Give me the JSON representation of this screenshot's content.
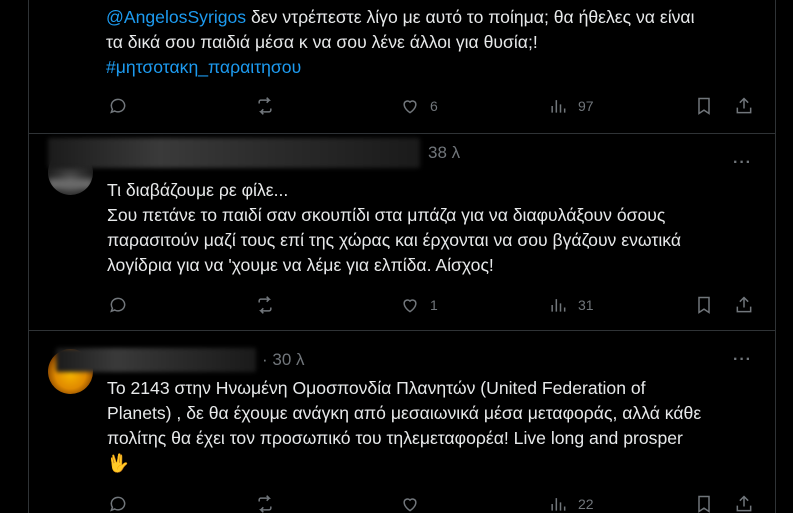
{
  "tweets": [
    {
      "line1_mention": "@AngelosSyrigos",
      "line1_rest": " δεν ντρέπεστε λίγο με αυτό το ποίημα; θα ήθελες να είναι",
      "line2": "τα δικά σου παιδιά μέσα κ να σου λένε άλλοι για θυσία;!",
      "hashtag": "#μητσοτακη_παραιτησου",
      "likes": "6",
      "views": "97"
    },
    {
      "time": "38 λ",
      "more": "···",
      "lines": [
        "Τι διαβάζουμε ρε φίλε...",
        "Σου πετάνε το παιδί σαν σκουπίδι στα μπάζα για να διαφυλάξουν όσους",
        "παρασιτούν μαζί τους επί της χώρας και έρχονται να σου βγάζουν ενωτικά",
        "λογίδρια για να 'χουμε να λέμε για ελπίδα. Αίσχος!"
      ],
      "likes": "1",
      "views": "31"
    },
    {
      "time": "· 30 λ",
      "more": "···",
      "lines": [
        "Το 2143 στην Ηνωμένη Ομοσπονδία Πλανητών (United Federation of",
        "Planets) , δε θα έχουμε ανάγκη από μεσαιωνικά μέσα μεταφοράς, αλλά κάθε",
        "πολίτης θα έχει τον προσωπικό του τηλεμεταφορέα! Live long and prosper",
        "🖖"
      ],
      "views": "22"
    }
  ],
  "icons": [
    "reply-icon",
    "repost-icon",
    "like-icon",
    "views-icon",
    "bookmark-icon",
    "share-icon"
  ],
  "colors": {
    "background": "#000000",
    "text": "#e7e9ea",
    "muted": "#71767b",
    "link": "#1d9bf0",
    "border": "#2f3336"
  }
}
